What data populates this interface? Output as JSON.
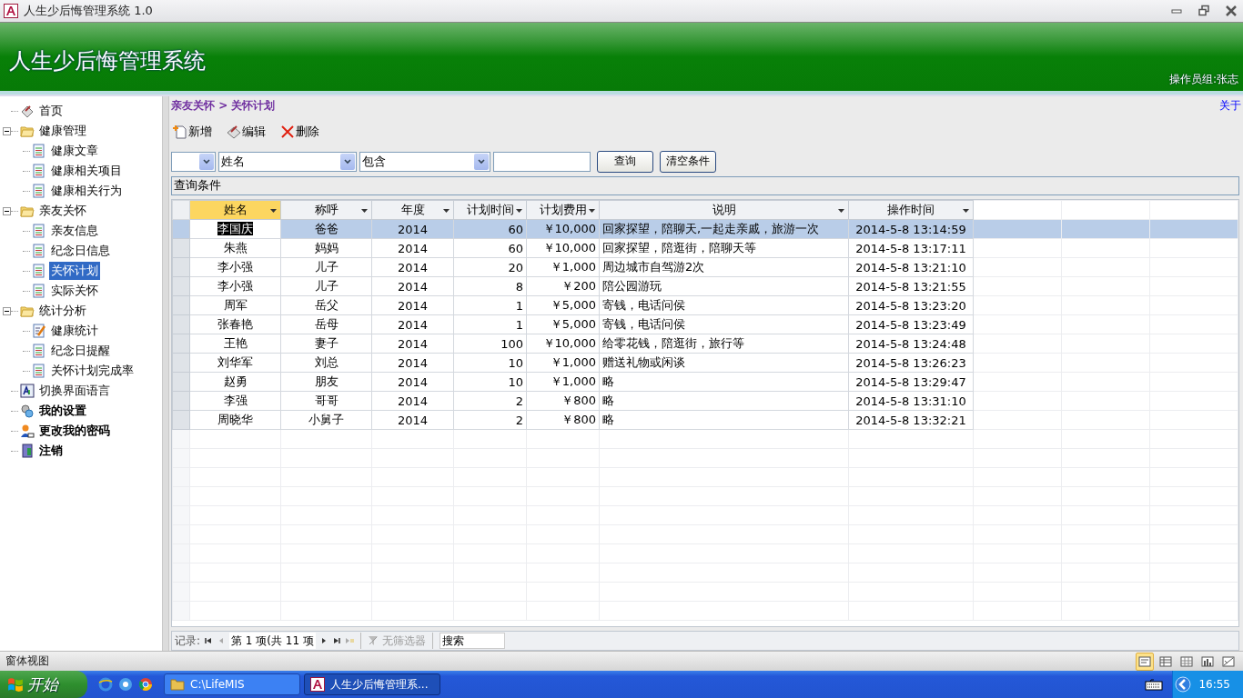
{
  "window": {
    "title": "人生少后悔管理系统 1.0"
  },
  "banner": {
    "title": "人生少后悔管理系统",
    "operator": "操作员组:张志"
  },
  "tree": [
    {
      "label": "首页",
      "kind": "home",
      "bold": false,
      "selected": false
    },
    {
      "label": "健康管理",
      "kind": "folder",
      "bold": false,
      "selected": false,
      "expanded": true,
      "children": [
        {
          "label": "健康文章",
          "kind": "page",
          "bold": false,
          "selected": false
        },
        {
          "label": "健康相关项目",
          "kind": "page",
          "bold": false,
          "selected": false
        },
        {
          "label": "健康相关行为",
          "kind": "page",
          "bold": false,
          "selected": false
        }
      ]
    },
    {
      "label": "亲友关怀",
      "kind": "folder",
      "bold": false,
      "selected": false,
      "expanded": true,
      "children": [
        {
          "label": "亲友信息",
          "kind": "page",
          "bold": false,
          "selected": false
        },
        {
          "label": "纪念日信息",
          "kind": "page",
          "bold": false,
          "selected": false
        },
        {
          "label": "关怀计划",
          "kind": "page",
          "bold": false,
          "selected": true
        },
        {
          "label": "实际关怀",
          "kind": "page",
          "bold": false,
          "selected": false
        }
      ]
    },
    {
      "label": "统计分析",
      "kind": "folder",
      "bold": false,
      "selected": false,
      "expanded": true,
      "children": [
        {
          "label": "健康统计",
          "kind": "edit",
          "bold": false,
          "selected": false
        },
        {
          "label": "纪念日提醒",
          "kind": "page",
          "bold": false,
          "selected": false
        },
        {
          "label": "关怀计划完成率",
          "kind": "page",
          "bold": false,
          "selected": false
        }
      ]
    },
    {
      "label": "切换界面语言",
      "kind": "language",
      "bold": false,
      "selected": false
    },
    {
      "label": "我的设置",
      "kind": "settings",
      "bold": true,
      "selected": false
    },
    {
      "label": "更改我的密码",
      "kind": "user",
      "bold": true,
      "selected": false
    },
    {
      "label": "注销",
      "kind": "logout",
      "bold": true,
      "selected": false
    }
  ],
  "breadcrumb": "亲友关怀 > 关怀计划",
  "about_link": "关于",
  "toolbar": [
    {
      "label": "新增",
      "kind": "add"
    },
    {
      "label": "编辑",
      "kind": "edit"
    },
    {
      "label": "删除",
      "kind": "delete"
    }
  ],
  "filter": {
    "field_2": "姓名",
    "operator": "包含",
    "buttons": [
      "查询",
      "清空条件"
    ],
    "condition": "查询条件"
  },
  "table": {
    "columns": [
      {
        "label": "姓名",
        "active": true
      },
      {
        "label": "称呼",
        "active": false
      },
      {
        "label": "年度",
        "active": false
      },
      {
        "label": "计划时间",
        "active": false
      },
      {
        "label": "计划费用",
        "active": false
      },
      {
        "label": "说明",
        "active": false
      },
      {
        "label": "操作时间",
        "active": false
      }
    ],
    "rows": [
      {
        "selected": true,
        "cells": [
          "李国庆",
          "爸爸",
          "2014",
          "60",
          "￥10,000",
          "回家探望，陪聊天,一起走亲戚，旅游一次",
          "2014-5-8 13:14:59"
        ]
      },
      {
        "selected": false,
        "cells": [
          "朱燕",
          "妈妈",
          "2014",
          "60",
          "￥10,000",
          "回家探望，陪逛街，陪聊天等",
          "2014-5-8 13:17:11"
        ]
      },
      {
        "selected": false,
        "cells": [
          "李小强",
          "儿子",
          "2014",
          "20",
          "￥1,000",
          "周边城市自驾游2次",
          "2014-5-8 13:21:10"
        ]
      },
      {
        "selected": false,
        "cells": [
          "李小强",
          "儿子",
          "2014",
          "8",
          "￥200",
          "陪公园游玩",
          "2014-5-8 13:21:55"
        ]
      },
      {
        "selected": false,
        "cells": [
          "周军",
          "岳父",
          "2014",
          "1",
          "￥5,000",
          "寄钱，电话问侯",
          "2014-5-8 13:23:20"
        ]
      },
      {
        "selected": false,
        "cells": [
          "张春艳",
          "岳母",
          "2014",
          "1",
          "￥5,000",
          "寄钱，电话问侯",
          "2014-5-8 13:23:49"
        ]
      },
      {
        "selected": false,
        "cells": [
          "王艳",
          "妻子",
          "2014",
          "100",
          "￥10,000",
          "给零花钱，陪逛街，旅行等",
          "2014-5-8 13:24:48"
        ]
      },
      {
        "selected": false,
        "cells": [
          "刘华军",
          "刘总",
          "2014",
          "10",
          "￥1,000",
          "赠送礼物或闲谈",
          "2014-5-8 13:26:23"
        ]
      },
      {
        "selected": false,
        "cells": [
          "赵勇",
          "朋友",
          "2014",
          "10",
          "￥1,000",
          "略",
          "2014-5-8 13:29:47"
        ]
      },
      {
        "selected": false,
        "cells": [
          "李强",
          "哥哥",
          "2014",
          "2",
          "￥800",
          "略",
          "2014-5-8 13:31:10"
        ]
      },
      {
        "selected": false,
        "cells": [
          "周晓华",
          "小舅子",
          "2014",
          "2",
          "￥800",
          "略",
          "2014-5-8 13:32:21"
        ]
      }
    ]
  },
  "navigator": {
    "label": "记录:",
    "position": "第 1 项(共 11 项",
    "filter": "无筛选器",
    "search": "搜索"
  },
  "status_bar": {
    "text": "窗体视图",
    "views": [
      {
        "selected": true
      },
      {
        "selected": false
      },
      {
        "selected": false
      },
      {
        "selected": false
      },
      {
        "selected": false
      }
    ]
  },
  "taskbar": {
    "start": "开始",
    "tasks": [
      {
        "label": "C:\\LifeMIS",
        "kind": "folder",
        "selected": false
      },
      {
        "label": "人生少后悔管理系...",
        "kind": "app",
        "selected": true
      }
    ],
    "clock": "16:55"
  }
}
